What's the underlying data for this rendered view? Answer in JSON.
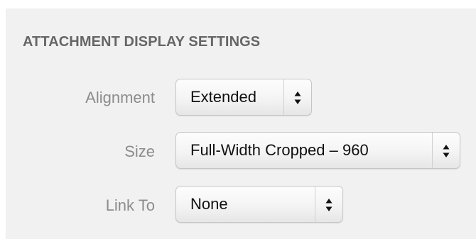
{
  "section": {
    "title": "ATTACHMENT DISPLAY SETTINGS"
  },
  "settings": {
    "alignment": {
      "label": "Alignment",
      "value": "Extended"
    },
    "size": {
      "label": "Size",
      "value": "Full-Width Cropped – 960"
    },
    "link_to": {
      "label": "Link To",
      "value": "None"
    }
  },
  "icons": {
    "select_arrows": "up-down-chevron-icon"
  },
  "colors": {
    "panel_background": "#f1f1f1",
    "heading_text": "#666666",
    "label_text": "#8c8c8c",
    "value_text": "#111111"
  }
}
